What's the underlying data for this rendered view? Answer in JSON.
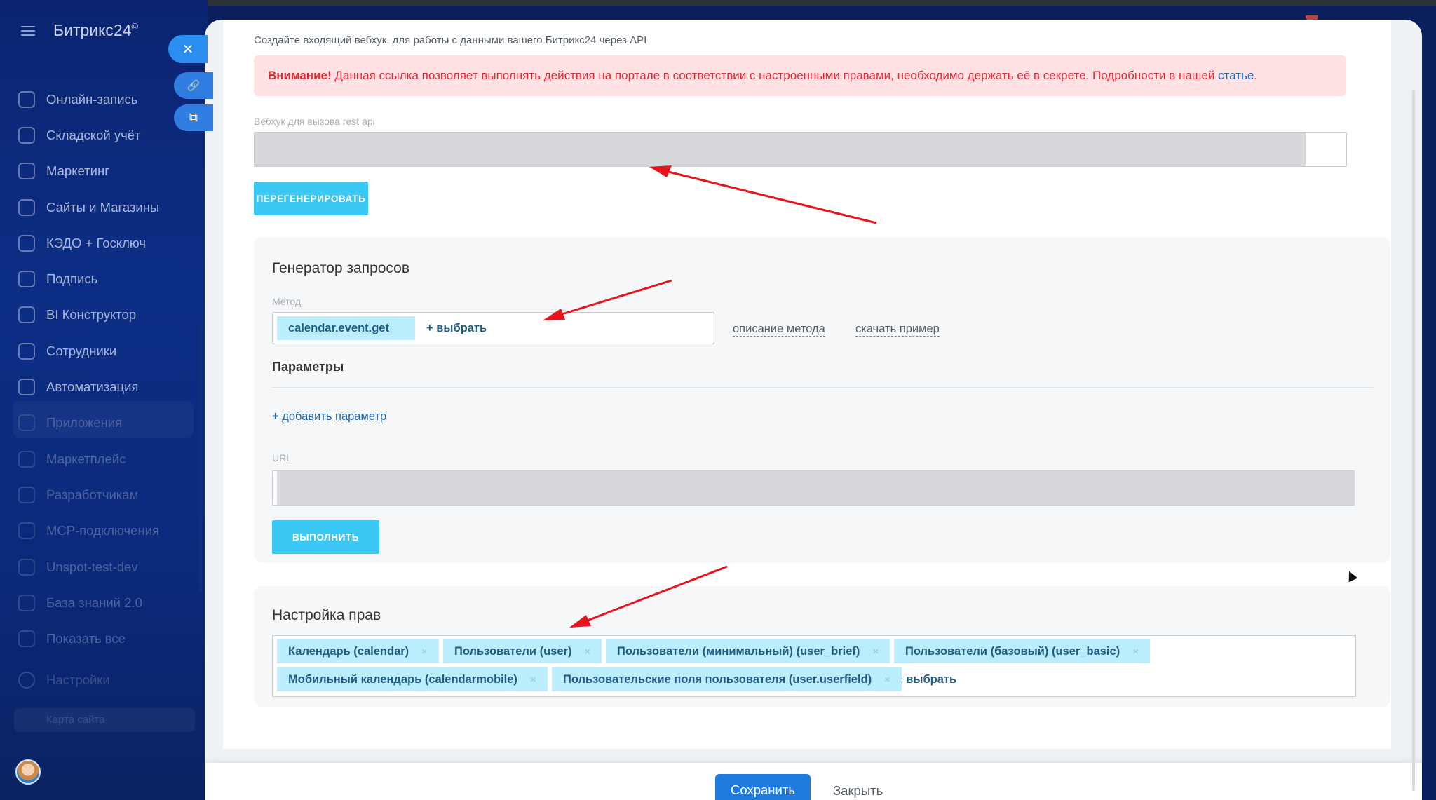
{
  "sidebar": {
    "brand": "Битрикс24",
    "brand_mark": "©",
    "items": [
      {
        "label": "Онлайн-запись",
        "icon": "calendar-booking-icon"
      },
      {
        "label": "Складской учёт",
        "icon": "warehouse-icon"
      },
      {
        "label": "Маркетинг",
        "icon": "marketing-icon"
      },
      {
        "label": "Сайты и Магазины",
        "icon": "cart-icon"
      },
      {
        "label": "КЭДО + Госключ",
        "icon": "document-icon"
      },
      {
        "label": "Подпись",
        "icon": "pen-icon"
      },
      {
        "label": "BI Конструктор",
        "icon": "bar-chart-icon"
      },
      {
        "label": "Сотрудники",
        "icon": "employees-icon"
      },
      {
        "label": "Автоматизация",
        "icon": "robot-icon"
      },
      {
        "label": "Приложения",
        "icon": "apps-icon"
      },
      {
        "label": "Маркетплейс",
        "icon": "marketplace-icon"
      },
      {
        "label": "Разработчикам",
        "icon": "code-icon"
      },
      {
        "label": "MCP-подключения",
        "icon": "mcp-icon"
      },
      {
        "label": "Unspot-test-dev",
        "icon": "app-u-icon"
      },
      {
        "label": "База знаний 2.0",
        "icon": "book-icon"
      },
      {
        "label": "Показать все",
        "icon": "chevron-down-icon"
      }
    ],
    "settings": "Настройки",
    "bottom_pill": "Карта сайта"
  },
  "slider_buttons": {
    "close": "✕",
    "link": "🔗",
    "external": "⧉"
  },
  "webhook": {
    "intro": "Создайте входящий вебхук, для работы с данными вашего Битрикс24 через API",
    "alert_bold": "Внимание!",
    "alert_text": " Данная ссылка позволяет выполнять действия на портале в соответствии с настроенными правами, необходимо держать её в секрете. Подробности в нашей ",
    "alert_link": "статье",
    "alert_end": ".",
    "field_label": "Вебхук для вызова rest api",
    "regenerate_label": "ПЕРЕГЕНЕРИРОВАТЬ"
  },
  "generator": {
    "title": "Генератор запросов",
    "method_label": "Метод",
    "method_value": "calendar.event.get",
    "choose_label": "+ выбрать",
    "method_description": "описание метода",
    "download_example": "скачать пример",
    "params_title": "Параметры",
    "add_param_plus": "+",
    "add_param": "добавить параметр",
    "url_label": "URL",
    "execute_label": "ВЫПОЛНИТЬ"
  },
  "rights": {
    "title": "Настройка прав",
    "scopes": [
      "Календарь (calendar)",
      "Пользователи (user)",
      "Пользователи (минимальный) (user_brief)",
      "Пользователи (базовый) (user_basic)",
      "Мобильный календарь (calendarmobile)",
      "Пользовательские поля пользователя (user.userfield)"
    ],
    "remove_glyph": "×",
    "choose_label": "+ выбрать"
  },
  "footer": {
    "save_label": "Сохранить",
    "close_label": "Закрыть"
  },
  "colors": {
    "accent": "#3bc8f5",
    "primary": "#1f7ae0",
    "alert_text": "#e22834",
    "alert_bg": "#ffe3e4",
    "tag_bg": "#bcedfc",
    "annotation_arrow": "#e8141c"
  }
}
